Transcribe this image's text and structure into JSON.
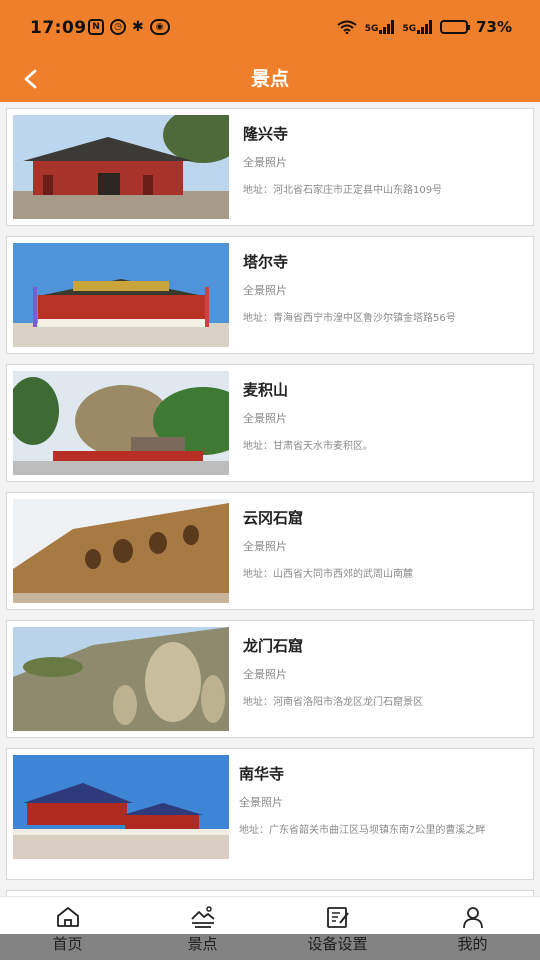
{
  "status": {
    "time": "17:09",
    "battery_text": "73%",
    "battery_level": 0.73,
    "net1": "5G",
    "net2": "5G",
    "wifi_tag": "7"
  },
  "header": {
    "title": "景点",
    "back_icon": "chevron-left-icon"
  },
  "colors": {
    "accent": "#ef7f2a"
  },
  "spots": [
    {
      "name": "隆兴寺",
      "tag": "全景照片",
      "address": "地址：河北省石家庄市正定县中山东路109号"
    },
    {
      "name": "塔尔寺",
      "tag": "全景照片",
      "address": "地址：青海省西宁市湟中区鲁沙尔镇金塔路56号"
    },
    {
      "name": "麦积山",
      "tag": "全景照片",
      "address": "地址：甘肃省天水市麦积区。"
    },
    {
      "name": "云冈石窟",
      "tag": "全景照片",
      "address": "地址：山西省大同市西郊的武周山南麓"
    },
    {
      "name": "龙门石窟",
      "tag": "全景照片",
      "address": "地址：河南省洛阳市洛龙区龙门石窟景区"
    },
    {
      "name": "南华寺",
      "tag": "全景照片",
      "address": "地址：广东省韶关市曲江区马坝镇东南7公里的曹溪之畔"
    }
  ],
  "tabs": [
    {
      "label": "首页",
      "icon": "home-icon"
    },
    {
      "label": "景点",
      "icon": "scenery-icon"
    },
    {
      "label": "设备设置",
      "icon": "edit-icon"
    },
    {
      "label": "我的",
      "icon": "user-icon"
    }
  ]
}
